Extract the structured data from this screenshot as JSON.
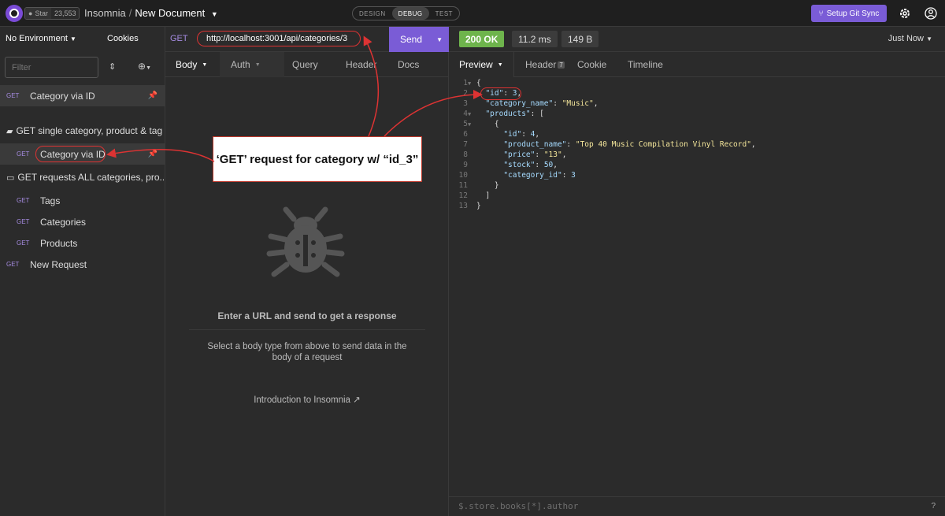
{
  "topbar": {
    "star_label": "Star",
    "star_count": "23,553",
    "app_name": "Insomnia",
    "separator": "/",
    "document_name": "New Document",
    "modes": [
      "DESIGN",
      "DEBUG",
      "TEST"
    ],
    "active_mode": "DEBUG",
    "git_sync_label": "Setup Git Sync"
  },
  "sidebar": {
    "environment": "No Environment",
    "cookies_label": "Cookies",
    "filter_placeholder": "Filter",
    "pinned_request": {
      "method": "GET",
      "name": "Category via ID"
    },
    "folder1": {
      "name": "GET single category, product & tag"
    },
    "folder1_request": {
      "method": "GET",
      "name": "Category via ID"
    },
    "folder2": {
      "name": "GET requests ALL categories, pro..."
    },
    "folder2_items": [
      {
        "method": "GET",
        "name": "Tags"
      },
      {
        "method": "GET",
        "name": "Categories"
      },
      {
        "method": "GET",
        "name": "Products"
      }
    ],
    "new_request": {
      "method": "GET",
      "name": "New Request"
    }
  },
  "request": {
    "method": "GET",
    "url": "http://localhost:3001/api/categories/3",
    "send_label": "Send",
    "tabs": [
      "Body",
      "Auth",
      "Query",
      "Header",
      "Docs"
    ],
    "empty_title": "Enter a URL and send to get a response",
    "empty_subtitle": "Select a body type from above to send data in the body of a request",
    "intro_link": "Introduction to Insomnia"
  },
  "response": {
    "status": "200 OK",
    "time": "11.2 ms",
    "size": "149 B",
    "timestamp": "Just Now",
    "tabs": [
      "Preview",
      "Header",
      "Cookie",
      "Timeline"
    ],
    "header_count": "7",
    "filter_placeholder": "$.store.books[*].author",
    "help": "?"
  },
  "annotation": {
    "text": "‘GET’ request for category w/ “id_3”"
  },
  "colors": {
    "accent": "#7a5cd6",
    "status_ok": "#6eb44c",
    "annotation_border": "#d33"
  }
}
